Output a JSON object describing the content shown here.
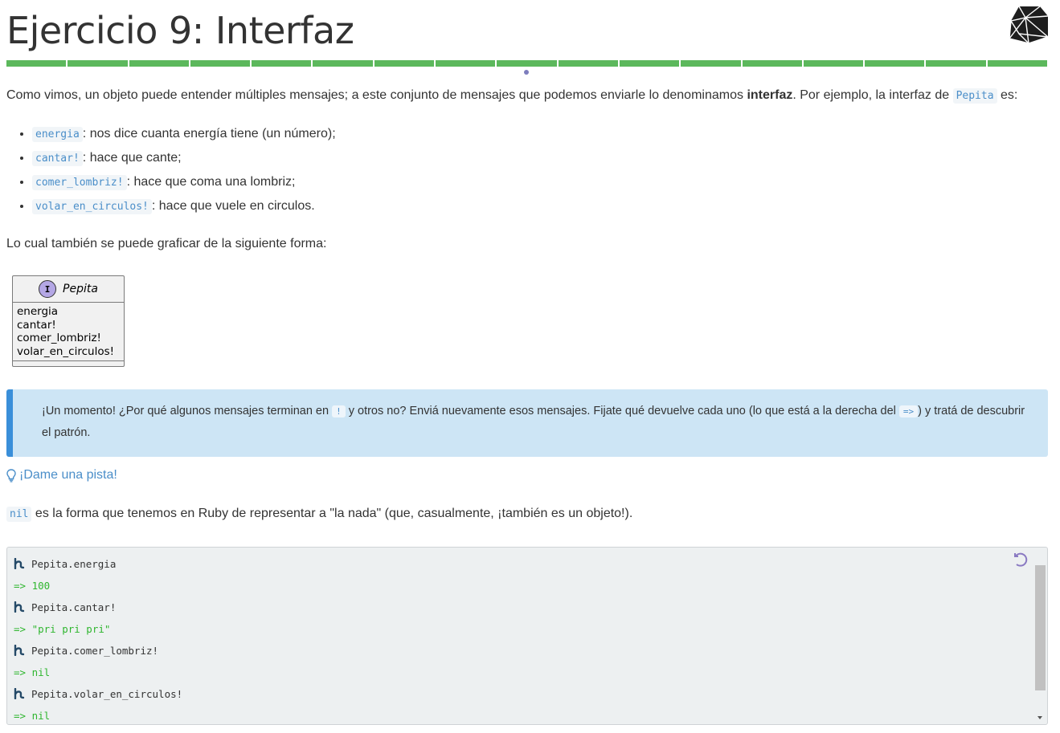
{
  "page": {
    "title": "Ejercicio 9: Interfaz",
    "progress_segments": 17
  },
  "intro": {
    "before": "Como vimos, un objeto puede entender múltiples mensajes; a este conjunto de mensajes que podemos enviarle lo denominamos ",
    "bold": "interfaz",
    "middle": ". Por ejemplo, la interfaz de ",
    "code": "Pepita",
    "after": " es:"
  },
  "messages": [
    {
      "code": "energia",
      "desc": ": nos dice cuanta energía tiene (un número);"
    },
    {
      "code": "cantar!",
      "desc": ": hace que cante;"
    },
    {
      "code": "comer_lombriz!",
      "desc": ": hace que coma una lombriz;"
    },
    {
      "code": "volar_en_circulos!",
      "desc": ": hace que vuele en circulos."
    }
  ],
  "graph_intro": "Lo cual también se puede graficar de la siguiente forma:",
  "uml": {
    "badge": "I",
    "name": "Pepita",
    "members": [
      "energia",
      "cantar!",
      "comer_lombriz!",
      "volar_en_circulos!"
    ]
  },
  "alert": {
    "part1": "¡Un momento! ¿Por qué algunos mensajes terminan en ",
    "code1": "!",
    "part2": " y otros no? Enviá nuevamente esos mensajes. Fijate qué devuelve cada uno (lo que está a la derecha del ",
    "code2": "=>",
    "part3": ") y tratá de descubrir el patrón."
  },
  "hint_label": "¡Dame una pista!",
  "nil_text": {
    "code": "nil",
    "rest": " es la forma que tenemos en Ruby de representar a \"la nada\" (que, casualmente, ¡también es un objeto!)."
  },
  "console": {
    "lines": [
      {
        "kind": "cmd",
        "text": "Pepita.energia"
      },
      {
        "kind": "res",
        "text": "=> 100"
      },
      {
        "kind": "cmd",
        "text": "Pepita.cantar!"
      },
      {
        "kind": "res",
        "text": "=> \"pri pri pri\""
      },
      {
        "kind": "cmd",
        "text": "Pepita.comer_lombriz!"
      },
      {
        "kind": "res",
        "text": "=> nil"
      },
      {
        "kind": "cmd",
        "text": "Pepita.volar_en_circulos!"
      },
      {
        "kind": "res",
        "text": "=> nil"
      }
    ]
  },
  "colors": {
    "progress": "#5cb85c",
    "link": "#4a8ec9",
    "alert_bg": "#cde5f5",
    "alert_border": "#3a8fd9",
    "result": "#2fb62f"
  },
  "icons": {
    "logo": "ruby-gem-icon",
    "hint": "lightbulb-icon",
    "prompt": "mumuki-prompt-icon",
    "reset": "undo-icon"
  }
}
